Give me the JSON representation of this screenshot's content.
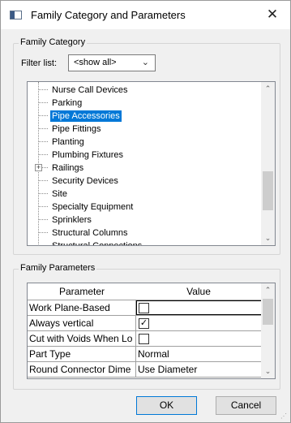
{
  "window": {
    "title": "Family Category and Parameters",
    "close_glyph": "✕",
    "app_icon": "dialog-icon"
  },
  "family_category": {
    "group_label": "Family Category",
    "filter_label": "Filter list:",
    "filter_value": "<show all>",
    "tree_items": [
      {
        "label": "Nurse Call Devices",
        "selected": false,
        "expandable": false
      },
      {
        "label": "Parking",
        "selected": false,
        "expandable": false
      },
      {
        "label": "Pipe Accessories",
        "selected": true,
        "expandable": false
      },
      {
        "label": "Pipe Fittings",
        "selected": false,
        "expandable": false
      },
      {
        "label": "Planting",
        "selected": false,
        "expandable": false
      },
      {
        "label": "Plumbing Fixtures",
        "selected": false,
        "expandable": false
      },
      {
        "label": "Railings",
        "selected": false,
        "expandable": true
      },
      {
        "label": "Security Devices",
        "selected": false,
        "expandable": false
      },
      {
        "label": "Site",
        "selected": false,
        "expandable": false
      },
      {
        "label": "Specialty Equipment",
        "selected": false,
        "expandable": false
      },
      {
        "label": "Sprinklers",
        "selected": false,
        "expandable": false
      },
      {
        "label": "Structural Columns",
        "selected": false,
        "expandable": false
      },
      {
        "label": "Structural Connections",
        "selected": false,
        "expandable": false
      }
    ],
    "expander_glyph": "+"
  },
  "family_parameters": {
    "group_label": "Family Parameters",
    "columns": [
      "Parameter",
      "Value"
    ],
    "rows": [
      {
        "parameter": "Work Plane-Based",
        "type": "checkbox",
        "checked": false,
        "focused": true
      },
      {
        "parameter": "Always vertical",
        "type": "checkbox",
        "checked": true,
        "focused": false
      },
      {
        "parameter": "Cut with Voids When Lo",
        "type": "checkbox",
        "checked": false,
        "focused": false
      },
      {
        "parameter": "Part Type",
        "type": "text",
        "value": "Normal",
        "focused": false
      },
      {
        "parameter": "Round Connector Dime",
        "type": "text",
        "value": "Use Diameter",
        "focused": false
      }
    ],
    "check_glyph": "✓"
  },
  "buttons": {
    "ok": "OK",
    "cancel": "Cancel"
  },
  "scroll_glyphs": {
    "up": "▲",
    "down": "▼"
  },
  "colors": {
    "selection": "#0078d7"
  }
}
